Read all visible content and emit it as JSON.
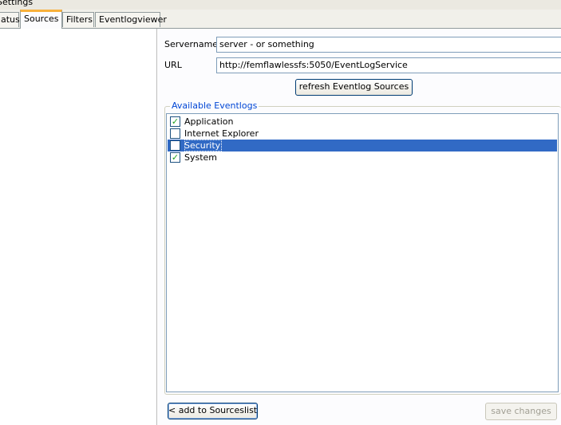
{
  "window": {
    "title": "Settings"
  },
  "tabs": [
    {
      "label": "Status",
      "visible_label": "atus",
      "active": false
    },
    {
      "label": "Sources",
      "active": true
    },
    {
      "label": "Filters",
      "active": false
    },
    {
      "label": "Eventlogviewer",
      "active": false
    }
  ],
  "form": {
    "servername_label": "Servername",
    "servername_value": "server - or something",
    "url_label": "URL",
    "url_value": "http://femflawlessfs:5050/EventLogService",
    "refresh_button": "refresh Eventlog Sources"
  },
  "eventlogs": {
    "group_label": "Available Eventlogs",
    "items": [
      {
        "label": "Application",
        "checked": true,
        "selected": false
      },
      {
        "label": "Internet Explorer",
        "checked": false,
        "selected": false
      },
      {
        "label": "Security",
        "checked": false,
        "selected": true
      },
      {
        "label": "System",
        "checked": true,
        "selected": false
      }
    ]
  },
  "footer": {
    "add_button": "< add to Sourceslist",
    "save_button": "save changes",
    "save_enabled": false
  },
  "colors": {
    "active_tab_accent": "#f8b13b",
    "selection": "#316ac5",
    "group_label": "#0046d5",
    "check_mark": "#21a121"
  }
}
